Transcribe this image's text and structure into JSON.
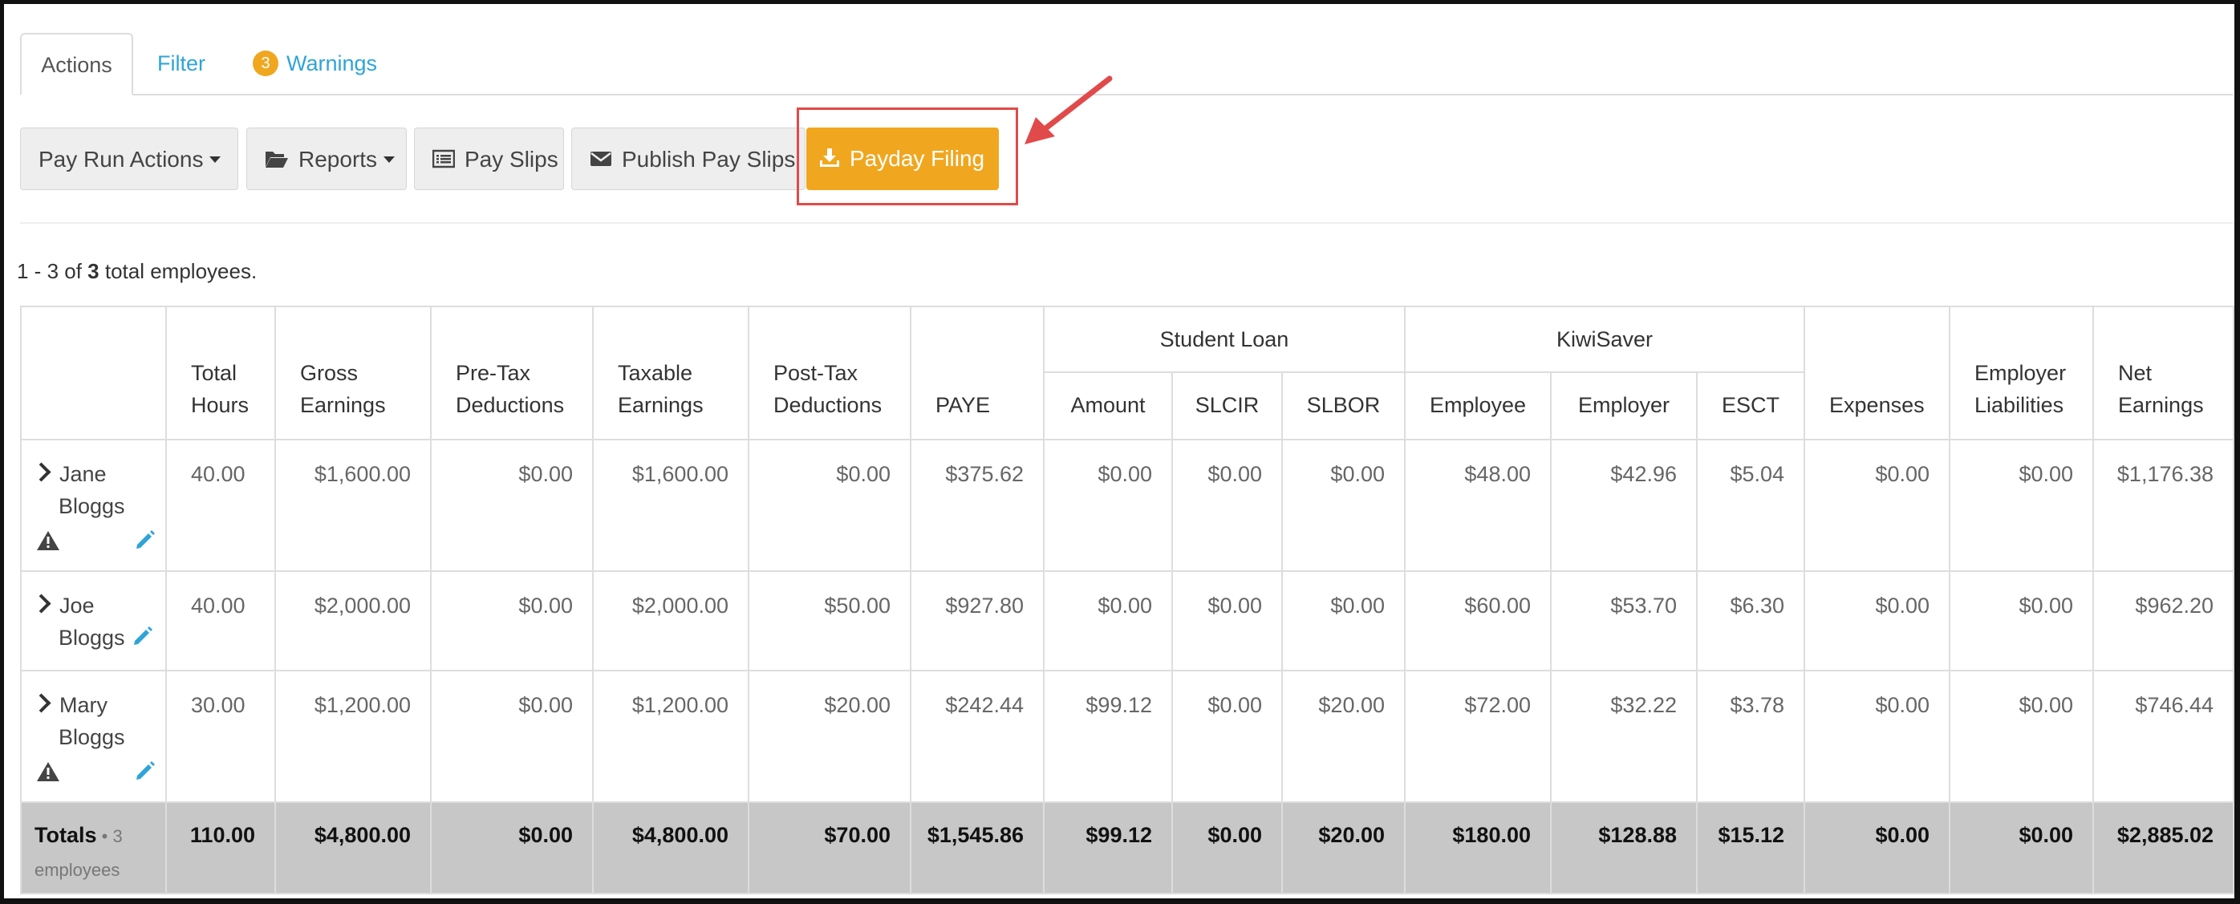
{
  "tabs": {
    "actions": "Actions",
    "filter": "Filter",
    "warnings_count": "3",
    "warnings": "Warnings"
  },
  "toolbar": {
    "pay_run_actions": "Pay Run Actions",
    "reports": "Reports",
    "pay_slips": "Pay Slips",
    "publish_pay_slips": "Publish Pay Slips",
    "payday_filing": "Payday Filing"
  },
  "summary": {
    "prefix": "1 - 3 of ",
    "total": "3",
    "suffix": " total employees."
  },
  "table": {
    "headers": {
      "total_hours": [
        "Total",
        "Hours"
      ],
      "gross_earnings": [
        "Gross",
        "Earnings"
      ],
      "pre_tax": [
        "Pre-Tax",
        "Deductions"
      ],
      "taxable": [
        "Taxable",
        "Earnings"
      ],
      "post_tax": [
        "Post-Tax",
        "Deductions"
      ],
      "paye": "PAYE",
      "student_loan": "Student Loan",
      "sl_amount": "Amount",
      "slcir": "SLCIR",
      "slbor": "SLBOR",
      "kiwisaver": "KiwiSaver",
      "ks_employee": "Employee",
      "ks_employer": "Employer",
      "esct": "ESCT",
      "expenses": "Expenses",
      "employer_liabilities": [
        "Employer",
        "Liabilities"
      ],
      "net_earnings": [
        "Net",
        "Earnings"
      ]
    },
    "rows": [
      {
        "first": "Jane",
        "last": "Bloggs",
        "warning": true,
        "values": [
          "40.00",
          "$1,600.00",
          "$0.00",
          "$1,600.00",
          "$0.00",
          "$375.62",
          "$0.00",
          "$0.00",
          "$0.00",
          "$48.00",
          "$42.96",
          "$5.04",
          "$0.00",
          "$0.00",
          "$1,176.38"
        ]
      },
      {
        "first": "Joe",
        "last": "Bloggs",
        "warning": false,
        "values": [
          "40.00",
          "$2,000.00",
          "$0.00",
          "$2,000.00",
          "$50.00",
          "$927.80",
          "$0.00",
          "$0.00",
          "$0.00",
          "$60.00",
          "$53.70",
          "$6.30",
          "$0.00",
          "$0.00",
          "$962.20"
        ]
      },
      {
        "first": "Mary",
        "last": "Bloggs",
        "warning": true,
        "values": [
          "30.00",
          "$1,200.00",
          "$0.00",
          "$1,200.00",
          "$20.00",
          "$242.44",
          "$99.12",
          "$0.00",
          "$20.00",
          "$72.00",
          "$32.22",
          "$3.78",
          "$0.00",
          "$0.00",
          "$746.44"
        ]
      }
    ],
    "totals": {
      "label": "Totals",
      "sub": " • 3 employees",
      "values": [
        "110.00",
        "$4,800.00",
        "$0.00",
        "$4,800.00",
        "$70.00",
        "$1,545.86",
        "$99.12",
        "$0.00",
        "$20.00",
        "$180.00",
        "$128.88",
        "$15.12",
        "$0.00",
        "$0.00",
        "$2,885.02"
      ]
    }
  },
  "colors": {
    "accent_orange": "#f0a71f",
    "link_blue": "#2fa4d8",
    "highlight_red": "#e14a4a",
    "totals_bg": "#c7c7c7"
  }
}
